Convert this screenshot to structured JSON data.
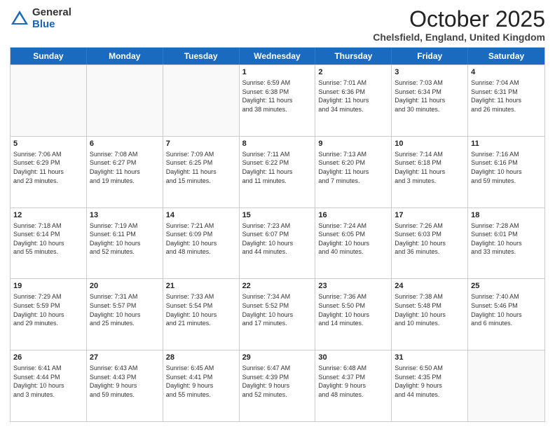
{
  "header": {
    "logo_line1": "General",
    "logo_line2": "Blue",
    "month": "October 2025",
    "location": "Chelsfield, England, United Kingdom"
  },
  "weekdays": [
    "Sunday",
    "Monday",
    "Tuesday",
    "Wednesday",
    "Thursday",
    "Friday",
    "Saturday"
  ],
  "weeks": [
    [
      {
        "day": "",
        "lines": []
      },
      {
        "day": "",
        "lines": []
      },
      {
        "day": "",
        "lines": []
      },
      {
        "day": "1",
        "lines": [
          "Sunrise: 6:59 AM",
          "Sunset: 6:38 PM",
          "Daylight: 11 hours",
          "and 38 minutes."
        ]
      },
      {
        "day": "2",
        "lines": [
          "Sunrise: 7:01 AM",
          "Sunset: 6:36 PM",
          "Daylight: 11 hours",
          "and 34 minutes."
        ]
      },
      {
        "day": "3",
        "lines": [
          "Sunrise: 7:03 AM",
          "Sunset: 6:34 PM",
          "Daylight: 11 hours",
          "and 30 minutes."
        ]
      },
      {
        "day": "4",
        "lines": [
          "Sunrise: 7:04 AM",
          "Sunset: 6:31 PM",
          "Daylight: 11 hours",
          "and 26 minutes."
        ]
      }
    ],
    [
      {
        "day": "5",
        "lines": [
          "Sunrise: 7:06 AM",
          "Sunset: 6:29 PM",
          "Daylight: 11 hours",
          "and 23 minutes."
        ]
      },
      {
        "day": "6",
        "lines": [
          "Sunrise: 7:08 AM",
          "Sunset: 6:27 PM",
          "Daylight: 11 hours",
          "and 19 minutes."
        ]
      },
      {
        "day": "7",
        "lines": [
          "Sunrise: 7:09 AM",
          "Sunset: 6:25 PM",
          "Daylight: 11 hours",
          "and 15 minutes."
        ]
      },
      {
        "day": "8",
        "lines": [
          "Sunrise: 7:11 AM",
          "Sunset: 6:22 PM",
          "Daylight: 11 hours",
          "and 11 minutes."
        ]
      },
      {
        "day": "9",
        "lines": [
          "Sunrise: 7:13 AM",
          "Sunset: 6:20 PM",
          "Daylight: 11 hours",
          "and 7 minutes."
        ]
      },
      {
        "day": "10",
        "lines": [
          "Sunrise: 7:14 AM",
          "Sunset: 6:18 PM",
          "Daylight: 11 hours",
          "and 3 minutes."
        ]
      },
      {
        "day": "11",
        "lines": [
          "Sunrise: 7:16 AM",
          "Sunset: 6:16 PM",
          "Daylight: 10 hours",
          "and 59 minutes."
        ]
      }
    ],
    [
      {
        "day": "12",
        "lines": [
          "Sunrise: 7:18 AM",
          "Sunset: 6:14 PM",
          "Daylight: 10 hours",
          "and 55 minutes."
        ]
      },
      {
        "day": "13",
        "lines": [
          "Sunrise: 7:19 AM",
          "Sunset: 6:11 PM",
          "Daylight: 10 hours",
          "and 52 minutes."
        ]
      },
      {
        "day": "14",
        "lines": [
          "Sunrise: 7:21 AM",
          "Sunset: 6:09 PM",
          "Daylight: 10 hours",
          "and 48 minutes."
        ]
      },
      {
        "day": "15",
        "lines": [
          "Sunrise: 7:23 AM",
          "Sunset: 6:07 PM",
          "Daylight: 10 hours",
          "and 44 minutes."
        ]
      },
      {
        "day": "16",
        "lines": [
          "Sunrise: 7:24 AM",
          "Sunset: 6:05 PM",
          "Daylight: 10 hours",
          "and 40 minutes."
        ]
      },
      {
        "day": "17",
        "lines": [
          "Sunrise: 7:26 AM",
          "Sunset: 6:03 PM",
          "Daylight: 10 hours",
          "and 36 minutes."
        ]
      },
      {
        "day": "18",
        "lines": [
          "Sunrise: 7:28 AM",
          "Sunset: 6:01 PM",
          "Daylight: 10 hours",
          "and 33 minutes."
        ]
      }
    ],
    [
      {
        "day": "19",
        "lines": [
          "Sunrise: 7:29 AM",
          "Sunset: 5:59 PM",
          "Daylight: 10 hours",
          "and 29 minutes."
        ]
      },
      {
        "day": "20",
        "lines": [
          "Sunrise: 7:31 AM",
          "Sunset: 5:57 PM",
          "Daylight: 10 hours",
          "and 25 minutes."
        ]
      },
      {
        "day": "21",
        "lines": [
          "Sunrise: 7:33 AM",
          "Sunset: 5:54 PM",
          "Daylight: 10 hours",
          "and 21 minutes."
        ]
      },
      {
        "day": "22",
        "lines": [
          "Sunrise: 7:34 AM",
          "Sunset: 5:52 PM",
          "Daylight: 10 hours",
          "and 17 minutes."
        ]
      },
      {
        "day": "23",
        "lines": [
          "Sunrise: 7:36 AM",
          "Sunset: 5:50 PM",
          "Daylight: 10 hours",
          "and 14 minutes."
        ]
      },
      {
        "day": "24",
        "lines": [
          "Sunrise: 7:38 AM",
          "Sunset: 5:48 PM",
          "Daylight: 10 hours",
          "and 10 minutes."
        ]
      },
      {
        "day": "25",
        "lines": [
          "Sunrise: 7:40 AM",
          "Sunset: 5:46 PM",
          "Daylight: 10 hours",
          "and 6 minutes."
        ]
      }
    ],
    [
      {
        "day": "26",
        "lines": [
          "Sunrise: 6:41 AM",
          "Sunset: 4:44 PM",
          "Daylight: 10 hours",
          "and 3 minutes."
        ]
      },
      {
        "day": "27",
        "lines": [
          "Sunrise: 6:43 AM",
          "Sunset: 4:43 PM",
          "Daylight: 9 hours",
          "and 59 minutes."
        ]
      },
      {
        "day": "28",
        "lines": [
          "Sunrise: 6:45 AM",
          "Sunset: 4:41 PM",
          "Daylight: 9 hours",
          "and 55 minutes."
        ]
      },
      {
        "day": "29",
        "lines": [
          "Sunrise: 6:47 AM",
          "Sunset: 4:39 PM",
          "Daylight: 9 hours",
          "and 52 minutes."
        ]
      },
      {
        "day": "30",
        "lines": [
          "Sunrise: 6:48 AM",
          "Sunset: 4:37 PM",
          "Daylight: 9 hours",
          "and 48 minutes."
        ]
      },
      {
        "day": "31",
        "lines": [
          "Sunrise: 6:50 AM",
          "Sunset: 4:35 PM",
          "Daylight: 9 hours",
          "and 44 minutes."
        ]
      },
      {
        "day": "",
        "lines": []
      }
    ]
  ]
}
